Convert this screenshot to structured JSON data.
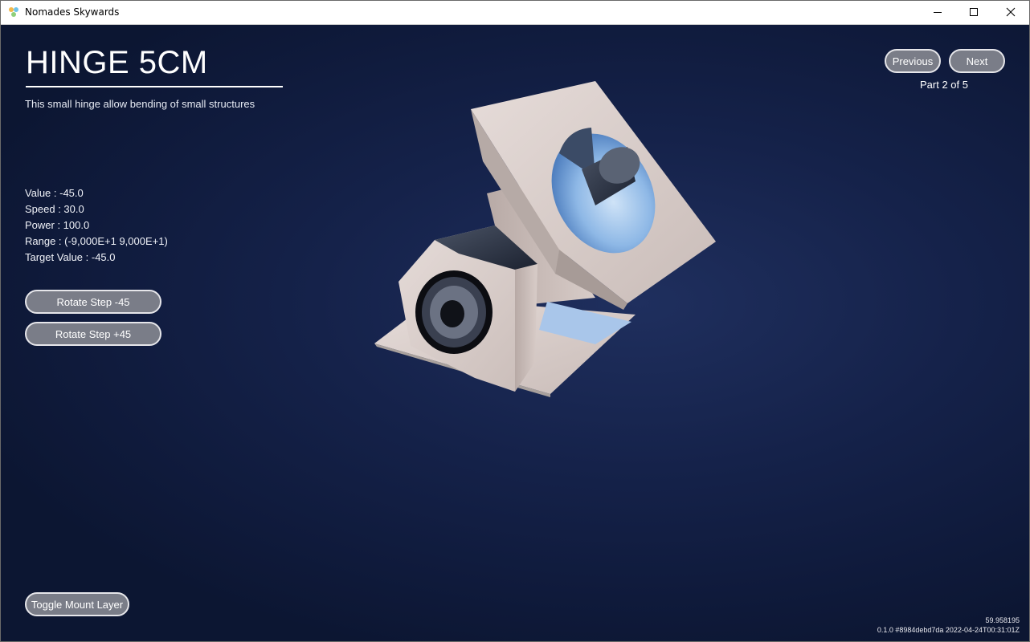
{
  "window": {
    "title": "Nomades Skywards"
  },
  "part": {
    "title": "HINGE 5CM",
    "description": "This small hinge allow bending of small structures"
  },
  "stats": {
    "value": "Value : -45.0",
    "speed": "Speed : 30.0",
    "power": "Power : 100.0",
    "range": "Range : (-9,000E+1  9,000E+1)",
    "target": "Target Value : -45.0"
  },
  "buttons": {
    "rotate_minus": "Rotate Step -45",
    "rotate_plus": "Rotate Step +45",
    "previous": "Previous",
    "next": "Next",
    "toggle_mount": "Toggle Mount Layer"
  },
  "pager": {
    "text": "Part 2 of 5"
  },
  "footer": {
    "fps": "59.958195",
    "build": "0.1.0 #8984debd7da 2022-04-24T00:31:01Z"
  }
}
